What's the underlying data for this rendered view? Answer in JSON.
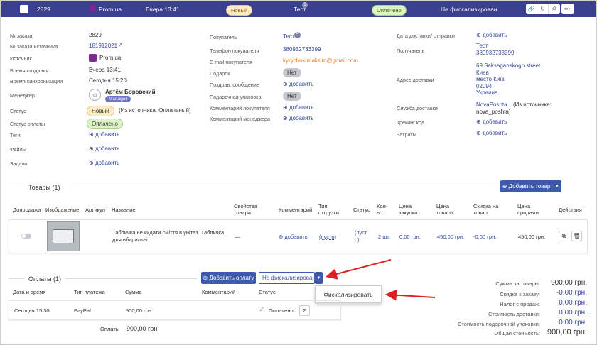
{
  "topbar": {
    "order_no": "2829",
    "source": "Prom.ua",
    "time": "Вчера 13:41",
    "status": "Новый",
    "customer": "Тест",
    "customer_count": "5",
    "payment": "Оплачено",
    "fiscal": "Не фискализирован",
    "icons": [
      "link-icon",
      "history-icon",
      "print-icon",
      "more-icon"
    ]
  },
  "left": {
    "labels": [
      "№ заказа",
      "№ заказа источника",
      "Источник",
      "Время создания",
      "Время синхронизации",
      "Менеджер",
      "Статус",
      "Статус оплаты",
      "Теги",
      "Файлы",
      "Задачи"
    ],
    "order_no": "2829",
    "source_order": "181912021",
    "source": "Prom.ua",
    "created": "Вчера 13:41",
    "synced": "Сегодня 15:20",
    "manager": "Артём Боровский",
    "manager_role": "Manager",
    "status": "Новый",
    "status_note": "(Из источника: Оплаченый)",
    "payment_status": "Оплачено",
    "add": "добавить"
  },
  "mid": {
    "labels": [
      "Покупатель",
      "Телефон покупателя",
      "E-mail покупателя",
      "Подарок",
      "Поздрав. сообщение",
      "Подарочная упаковка",
      "Комментарий покупателя",
      "Комментарий менеджера"
    ],
    "customer": "Тест",
    "customer_count": "5",
    "phone": "380932733399",
    "email": "kyrychok.maksim@gmail.com",
    "gift": "Нет",
    "wrap": "Нет",
    "add": "добавить"
  },
  "right": {
    "labels": [
      "Дата доставки/ отправки",
      "Получатель",
      "Адрес доставки",
      "Служба доставки",
      "Трекинг код",
      "Затраты"
    ],
    "recipient_name": "Тест",
    "recipient_phone": "380932733399",
    "address": [
      "69 Saksaganskogo street",
      "Киев",
      "место Київ",
      "02094",
      "Украина"
    ],
    "service": "NovaPoshta",
    "service_note": "(Из источника:",
    "service_note2": "nova_poshta)",
    "add": "добавить"
  },
  "goods": {
    "title": "Товары (1)",
    "add_btn": "Добавить товар",
    "headers": [
      "Допродажа",
      "Изображение",
      "Артикул",
      "Название",
      "Свойства товара",
      "Комментарий",
      "Тип отгрузки",
      "Статус",
      "Кол-во",
      "Цена закупки",
      "Цена товара",
      "Скидка на товар",
      "Цена продажи",
      "Действия"
    ],
    "row": {
      "name": "Табличка не кидати сміття в унітаз. Табличка для вбиральні",
      "props": "—",
      "comment": "добавить",
      "shipping": "(пусто)",
      "status": "(пусто)",
      "qty": "2 шт.",
      "purchase": "0,00 грн.",
      "price": "450,00 грн.",
      "discount": "-0,00 грн.",
      "sale": "450,00 грн."
    }
  },
  "payments": {
    "title": "Оплаты (1)",
    "add_btn": "Добавить оплату",
    "fiscal_select": "Не фискализирован",
    "fiscalize": "Фискализировать",
    "headers": [
      "Дата и время",
      "Тип платежа",
      "Сумма",
      "Комментарий",
      "Статус"
    ],
    "row": {
      "date": "Сегодня 15:30",
      "type": "PayPal",
      "sum": "900,00 грн.",
      "status": "Оплачено"
    },
    "total_label": "Оплаты",
    "total": "900,00 грн."
  },
  "summary": [
    {
      "label": "Сумма за товары:",
      "value": "900,00 грн."
    },
    {
      "label": "Скидка к заказу:",
      "value": "-0,00 грн."
    },
    {
      "label": "Налог с продаж:",
      "value": "0,00 грн."
    },
    {
      "label": "Стоимость доставки:",
      "value": "0,00 грн."
    },
    {
      "label": "Стоимость подарочной упаковки:",
      "value": "0,00 грн."
    },
    {
      "label": "Общая стоимость:",
      "value": "900,00 грн."
    }
  ]
}
